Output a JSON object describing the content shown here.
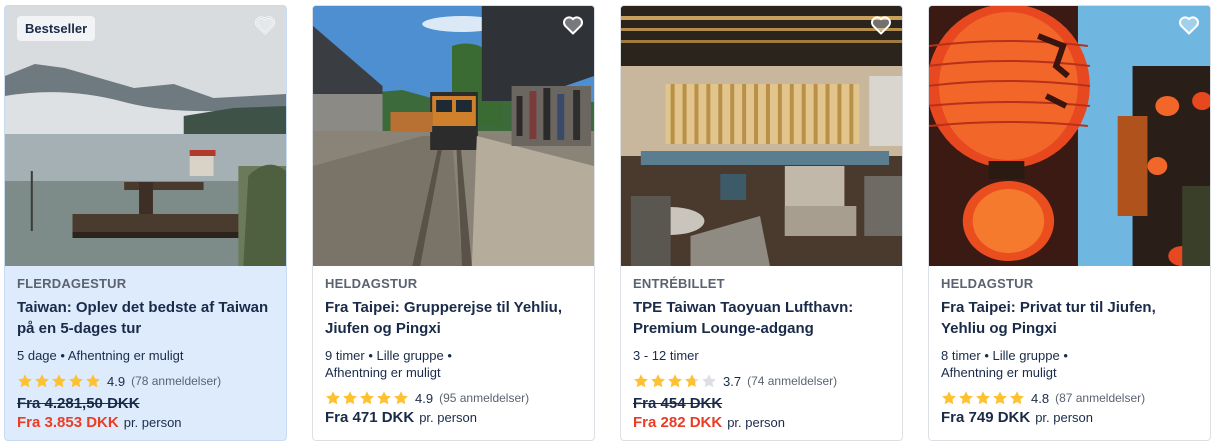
{
  "colors": {
    "deal_price": "#eb3c25",
    "star": "#fdc132",
    "star_empty": "#dcdfe4",
    "highlight_bg": "#ddebfc"
  },
  "cards": [
    {
      "badge": "Bestseller",
      "category": "FLERDAGESTUR",
      "title": "Taiwan: Oplev det bedste af Taiwan på en 5-dages tur",
      "meta": "5 dage • Afhentning er muligt",
      "rating": "4.9",
      "stars": 5,
      "reviews": "(78 anmeldelser)",
      "old_price": "Fra 4.281,50 DKK",
      "price": "Fra 3.853 DKK",
      "per": "pr. person",
      "image": "taiwan-lake-pier-photo",
      "wishlist_icon": "heart-icon"
    },
    {
      "category": "HELDAGSTUR",
      "title": "Fra Taipei: Grupperejse til Yehliu, Jiufen og Pingxi",
      "meta": "9 timer • Lille gruppe • Afhentning er muligt",
      "rating": "4.9",
      "stars": 5,
      "reviews": "(95 anmeldelser)",
      "price": "Fra 471 DKK",
      "per": "pr. person",
      "image": "train-station-photo",
      "wishlist_icon": "heart-icon"
    },
    {
      "category": "ENTRÉBILLET",
      "title": "TPE Taiwan Taoyuan Lufthavn: Premium Lounge-adgang",
      "meta": "3 - 12 timer",
      "rating": "3.7",
      "stars": 3.7,
      "reviews": "(74 anmeldelser)",
      "old_price": "Fra 454 DKK",
      "price": "Fra 282 DKK",
      "per": "pr. person",
      "image": "airport-lounge-photo",
      "wishlist_icon": "heart-icon"
    },
    {
      "category": "HELDAGSTUR",
      "title": "Fra Taipei: Privat tur til Jiufen, Yehliu og Pingxi",
      "meta": "8 timer • Lille gruppe • Afhentning er muligt",
      "rating": "4.8",
      "stars": 5,
      "reviews": "(87 anmeldelser)",
      "price": "Fra 749 DKK",
      "per": "pr. person",
      "image": "red-lanterns-photo",
      "wishlist_icon": "heart-icon"
    }
  ]
}
